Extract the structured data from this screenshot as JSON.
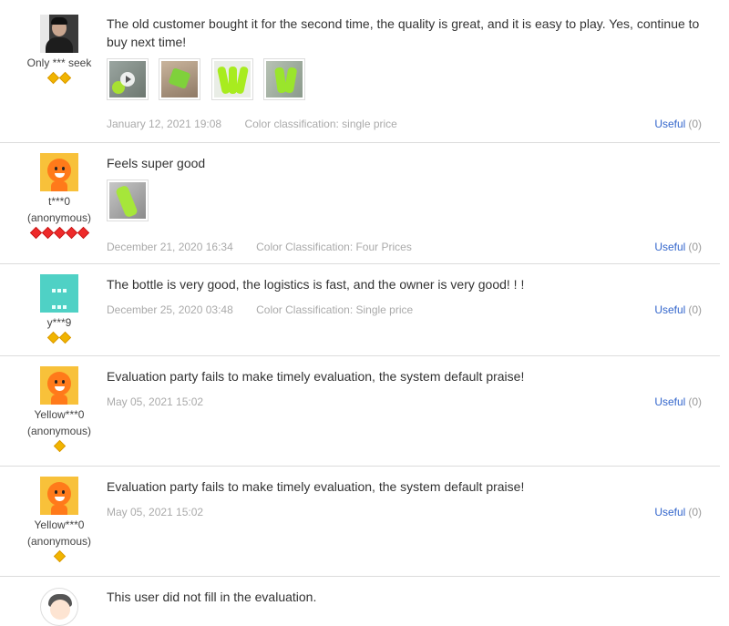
{
  "reviews": [
    {
      "username": "Only *** seek",
      "username_line2": "",
      "avatar": "user-photo",
      "rank_gems": 2,
      "rank_color": "#f0b400",
      "text": "The old customer bought it for the second time, the quality is great, and it is easy to play. Yes, continue to buy next time!",
      "photo_count": 4,
      "date": "January 12, 2021 19:08",
      "sku": "Color classification: single price",
      "useful_label": "Useful",
      "useful_count": "(0)"
    },
    {
      "username": "t***0",
      "username_line2": "(anonymous)",
      "avatar": "default-orange-mascot",
      "rank_gems": 5,
      "rank_color": "#ee2a2a",
      "text": "Feels super good",
      "photo_count": 1,
      "date": "December 21, 2020 16:34",
      "sku": "Color Classification: Four Prices",
      "useful_label": "Useful",
      "useful_count": "(0)"
    },
    {
      "username": "y***9",
      "username_line2": "",
      "avatar": "teal-pattern",
      "rank_gems": 2,
      "rank_color": "#f0b400",
      "text": "The bottle is very good, the logistics is fast, and the owner is very good! ! !",
      "photo_count": 0,
      "date": "December 25, 2020 03:48",
      "sku": "Color Classification: Single price",
      "useful_label": "Useful",
      "useful_count": "(0)"
    },
    {
      "username": "Yellow***0",
      "username_line2": "(anonymous)",
      "avatar": "default-orange-mascot",
      "rank_gems": 1,
      "rank_color": "#f0b400",
      "text": "Evaluation party fails to make timely evaluation, the system default praise!",
      "photo_count": 0,
      "date": "May 05, 2021 15:02",
      "sku": "",
      "useful_label": "Useful",
      "useful_count": "(0)"
    },
    {
      "username": "Yellow***0",
      "username_line2": "(anonymous)",
      "avatar": "default-orange-mascot",
      "rank_gems": 1,
      "rank_color": "#f0b400",
      "text": "Evaluation party fails to make timely evaluation, the system default praise!",
      "photo_count": 0,
      "date": "May 05, 2021 15:02",
      "sku": "",
      "useful_label": "Useful",
      "useful_count": "(0)"
    },
    {
      "username": "",
      "username_line2": "",
      "avatar": "girl-cartoon",
      "rank_gems": 0,
      "rank_color": "",
      "text": "This user did not fill in the evaluation.",
      "photo_count": 0,
      "date": "",
      "sku": "",
      "useful_label": "",
      "useful_count": ""
    }
  ],
  "colors": {
    "link": "#3366cc",
    "meta": "#aaaaaa",
    "divider": "#dcdcdc"
  }
}
